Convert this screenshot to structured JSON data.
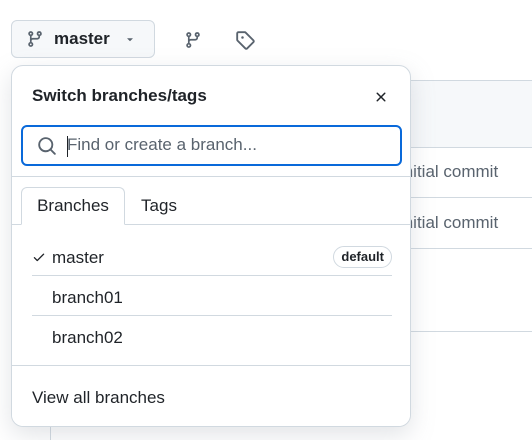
{
  "toolbar": {
    "branch_label": "master",
    "icons": [
      "git-branch-icon",
      "chevron-down-icon",
      "branches-icon",
      "tag-icon"
    ]
  },
  "background": {
    "rows": [
      {
        "commit_message": "Initial commit"
      },
      {
        "commit_message": "Initial commit"
      }
    ]
  },
  "dropdown": {
    "title": "Switch branches/tags",
    "search": {
      "placeholder": "Find or create a branch...",
      "value": ""
    },
    "tabs": [
      {
        "label": "Branches",
        "active": true
      },
      {
        "label": "Tags",
        "active": false
      }
    ],
    "branches": [
      {
        "name": "master",
        "selected": true,
        "badge": "default"
      },
      {
        "name": "branch01",
        "selected": false,
        "badge": ""
      },
      {
        "name": "branch02",
        "selected": false,
        "badge": ""
      }
    ],
    "footer_link": "View all branches"
  },
  "colors": {
    "accent": "#0969da",
    "border": "#d1d9e0",
    "text": "#1f2328",
    "muted": "#59636e",
    "button_bg": "#f6f8fa"
  }
}
